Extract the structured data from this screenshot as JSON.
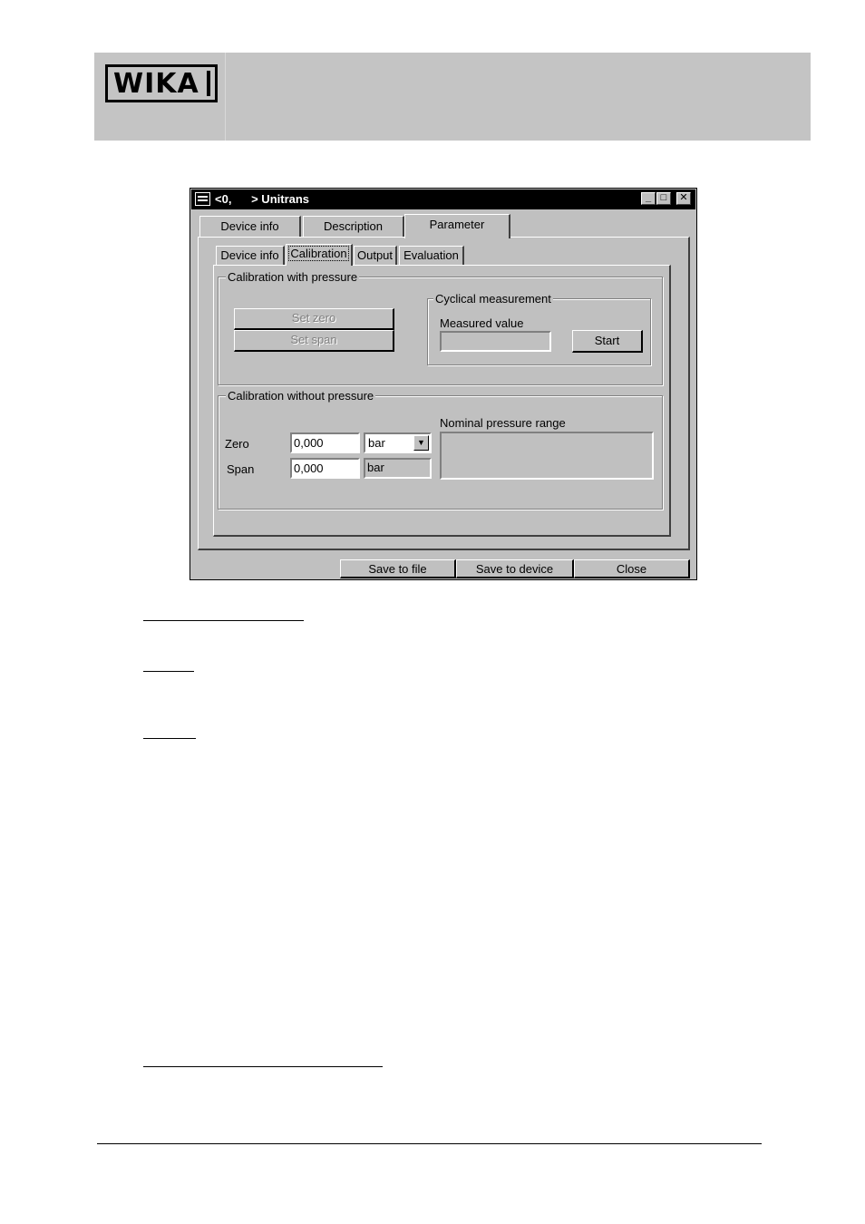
{
  "header": {
    "logo_text": "WIKA"
  },
  "window": {
    "title": "<0,      > Unitrans",
    "controls": {
      "minimize": "_",
      "maximize": "□",
      "close": "✕"
    },
    "outer_tabs": [
      "Device info",
      "Description",
      "Parameter"
    ],
    "inner_tabs": [
      "Device info",
      "Calibration",
      "Output",
      "Evaluation"
    ],
    "calibration_with_pressure": {
      "label": "Calibration with pressure",
      "set_zero": "Set zero",
      "set_span": "Set span",
      "cyclical": {
        "label": "Cyclical measurement",
        "measured_value_label": "Measured value",
        "measured_value": "",
        "start": "Start"
      }
    },
    "calibration_without_pressure": {
      "label": "Calibration without pressure",
      "zero_label": "Zero",
      "zero_value": "0,000",
      "span_label": "Span",
      "span_value": "0,000",
      "unit_selected": "bar",
      "span_unit": "bar",
      "nominal_label": "Nominal pressure range",
      "nominal_value": ""
    },
    "footer_buttons": {
      "save_to_file": "Save to file",
      "save_to_device": "Save to device",
      "close": "Close"
    }
  },
  "icons": {
    "window_icon": "app-window-icon",
    "dropdown": "chevron-down-icon"
  }
}
